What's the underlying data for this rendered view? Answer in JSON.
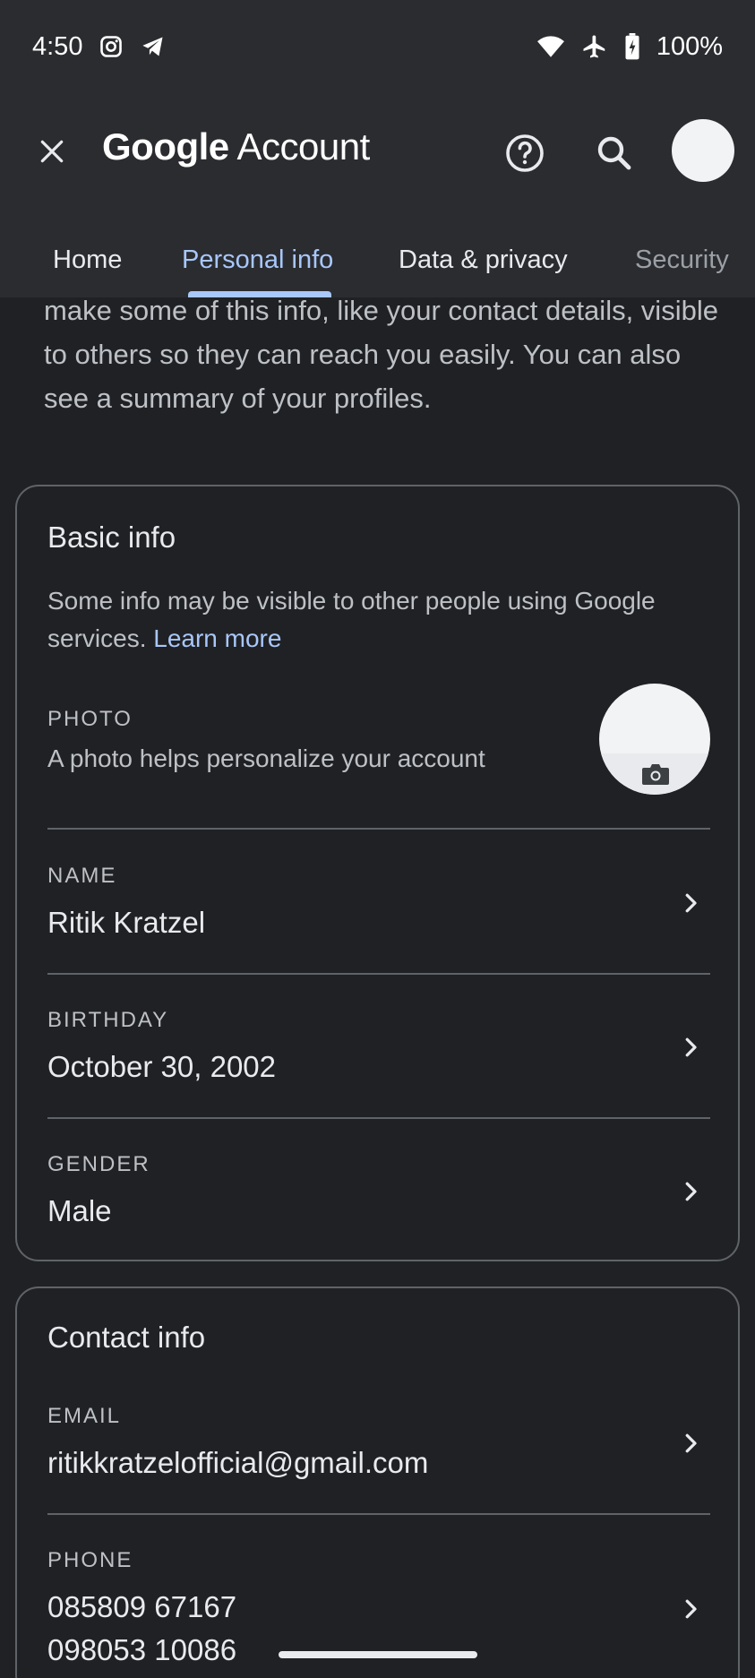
{
  "status_bar": {
    "time": "4:50",
    "left_icons": [
      "instagram-icon",
      "telegram-icon"
    ],
    "right_icons": [
      "wifi-icon",
      "airplane-icon",
      "battery-charging-icon"
    ],
    "battery": "100%"
  },
  "app_bar": {
    "title_google": "Google",
    "title_account": "Account",
    "close_icon": "close-icon",
    "help_icon": "help-icon",
    "search_icon": "search-icon"
  },
  "tabs": [
    {
      "label": "Home"
    },
    {
      "label": "Personal info",
      "active": true
    },
    {
      "label": "Data & privacy"
    },
    {
      "label": "Security"
    }
  ],
  "intro_text": "make some of this info, like your contact details, visible to others so they can reach you easily. You can also see a summary of your profiles.",
  "basic_info": {
    "title": "Basic info",
    "description": "Some info may be visible to other people using Google services.",
    "learn_more": "Learn more",
    "photo": {
      "label": "PHOTO",
      "description": "A photo helps personalize your account"
    },
    "rows": [
      {
        "label": "NAME",
        "value": "Ritik Kratzel"
      },
      {
        "label": "BIRTHDAY",
        "value": "October 30, 2002"
      },
      {
        "label": "GENDER",
        "value": "Male"
      }
    ]
  },
  "contact_info": {
    "title": "Contact info",
    "email": {
      "label": "EMAIL",
      "value": "ritikkratzelofficial@gmail.com"
    },
    "phone": {
      "label": "PHONE",
      "values": [
        "085809 67167",
        "098053 10086"
      ]
    }
  },
  "colors": {
    "background": "#202124",
    "app_bar": "#2b2c30",
    "accent": "#a8c7fa",
    "divider": "#5f6368"
  }
}
